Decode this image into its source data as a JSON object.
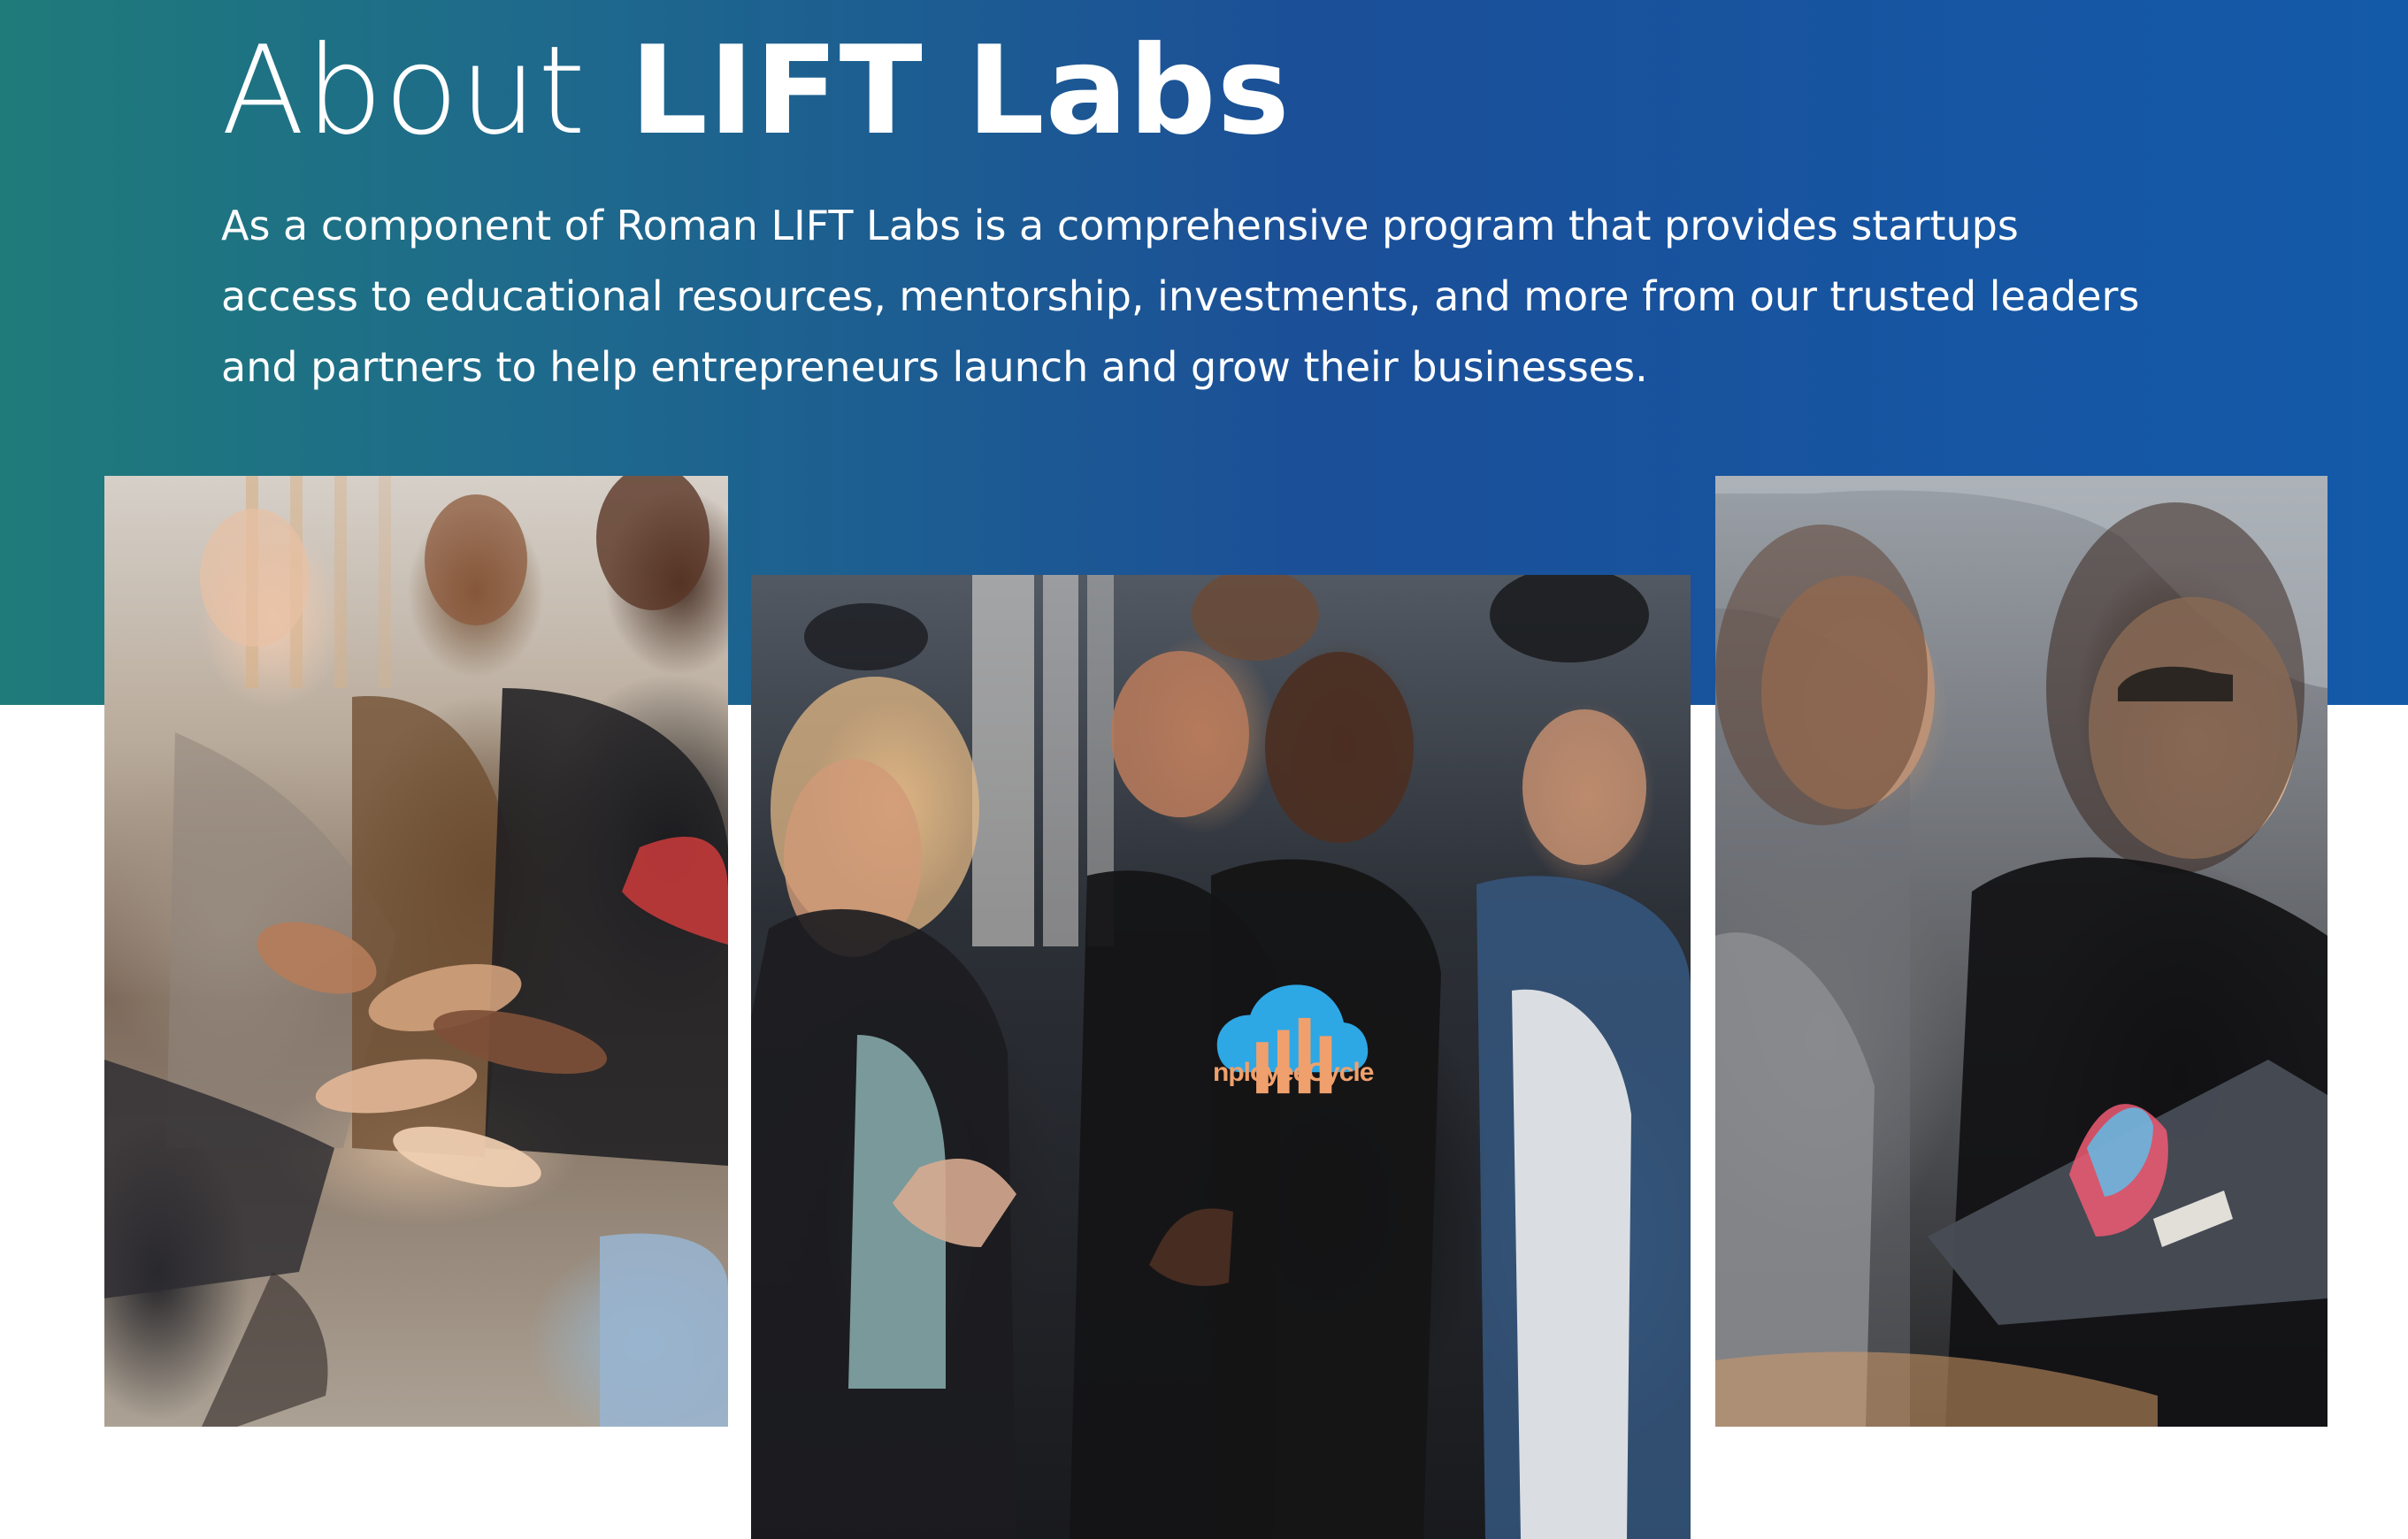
{
  "hero": {
    "title_light": "About",
    "title_bold": "LIFT Labs",
    "description": "As a component of Roman LIFT Labs is a comprehensive program that provides startups access to educational resources, mentorship, investments, and more from our trusted leaders and partners to help entrepreneurs launch and grow their businesses."
  },
  "gallery": {
    "middle": {
      "shirt_logo_text": "nployeeCycle"
    }
  },
  "colors": {
    "band_start": "#1f7b7a",
    "band_end": "#135aa9",
    "text_primary": "#ffffff",
    "accent_orange": "#f0a06c",
    "accent_blue": "#2ea7e5"
  },
  "icons": {
    "shirt_logo": "cloud-chart-icon"
  }
}
